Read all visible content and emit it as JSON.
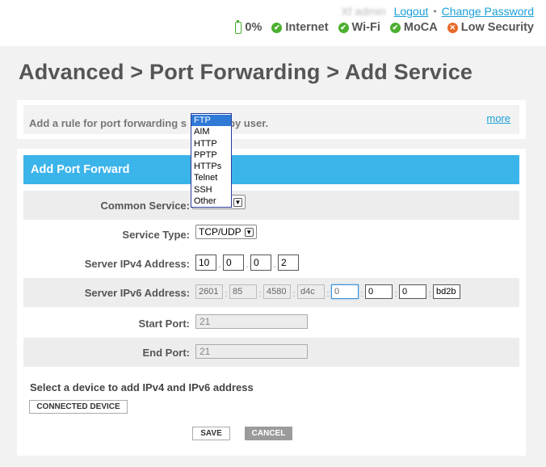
{
  "header": {
    "username": "Xf admin",
    "logout": "Logout",
    "separator": "•",
    "change_password": "Change Password",
    "battery": "0%",
    "status": [
      {
        "label": "Internet",
        "state": "ok"
      },
      {
        "label": "Wi-Fi",
        "state": "ok"
      },
      {
        "label": "MoCA",
        "state": "ok"
      },
      {
        "label": "Low Security",
        "state": "warn"
      }
    ],
    "colors": {
      "ok": "#4caf2f",
      "warn": "#e8692b",
      "link": "#1a9fd8",
      "accent": "#3bb4ea"
    }
  },
  "page_title": "Advanced > Port Forwarding > Add Service",
  "description": {
    "text_before": "Add a rule for port forwarding s",
    "text_after": "by user.",
    "more": "more"
  },
  "form": {
    "title": "Add Port Forward",
    "common_service": {
      "label": "Common Service:",
      "options": [
        "FTP",
        "AIM",
        "HTTP",
        "PPTP",
        "HTTPs",
        "Telnet",
        "SSH",
        "Other"
      ],
      "highlighted": "FTP",
      "arrow": "▼"
    },
    "service_type": {
      "label": "Service Type:",
      "value": "TCP/UDP",
      "arrow": "▼"
    },
    "ipv4": {
      "label": "Server IPv4 Address:",
      "octets": [
        "10",
        "0",
        "0",
        "2"
      ],
      "sep": "."
    },
    "ipv6": {
      "label": "Server IPv6 Address:",
      "groups": [
        "2601",
        "85",
        "4580",
        "d4c",
        "0",
        "0",
        "0",
        "bd2b"
      ],
      "sep": ":"
    },
    "start_port": {
      "label": "Start Port:",
      "value": "21"
    },
    "end_port": {
      "label": "End Port:",
      "value": "21"
    },
    "select_note": "Select a device to add IPv4 and IPv6 address",
    "connected_device": "CONNECTED DEVICE",
    "save": "SAVE",
    "cancel": "CANCEL"
  }
}
